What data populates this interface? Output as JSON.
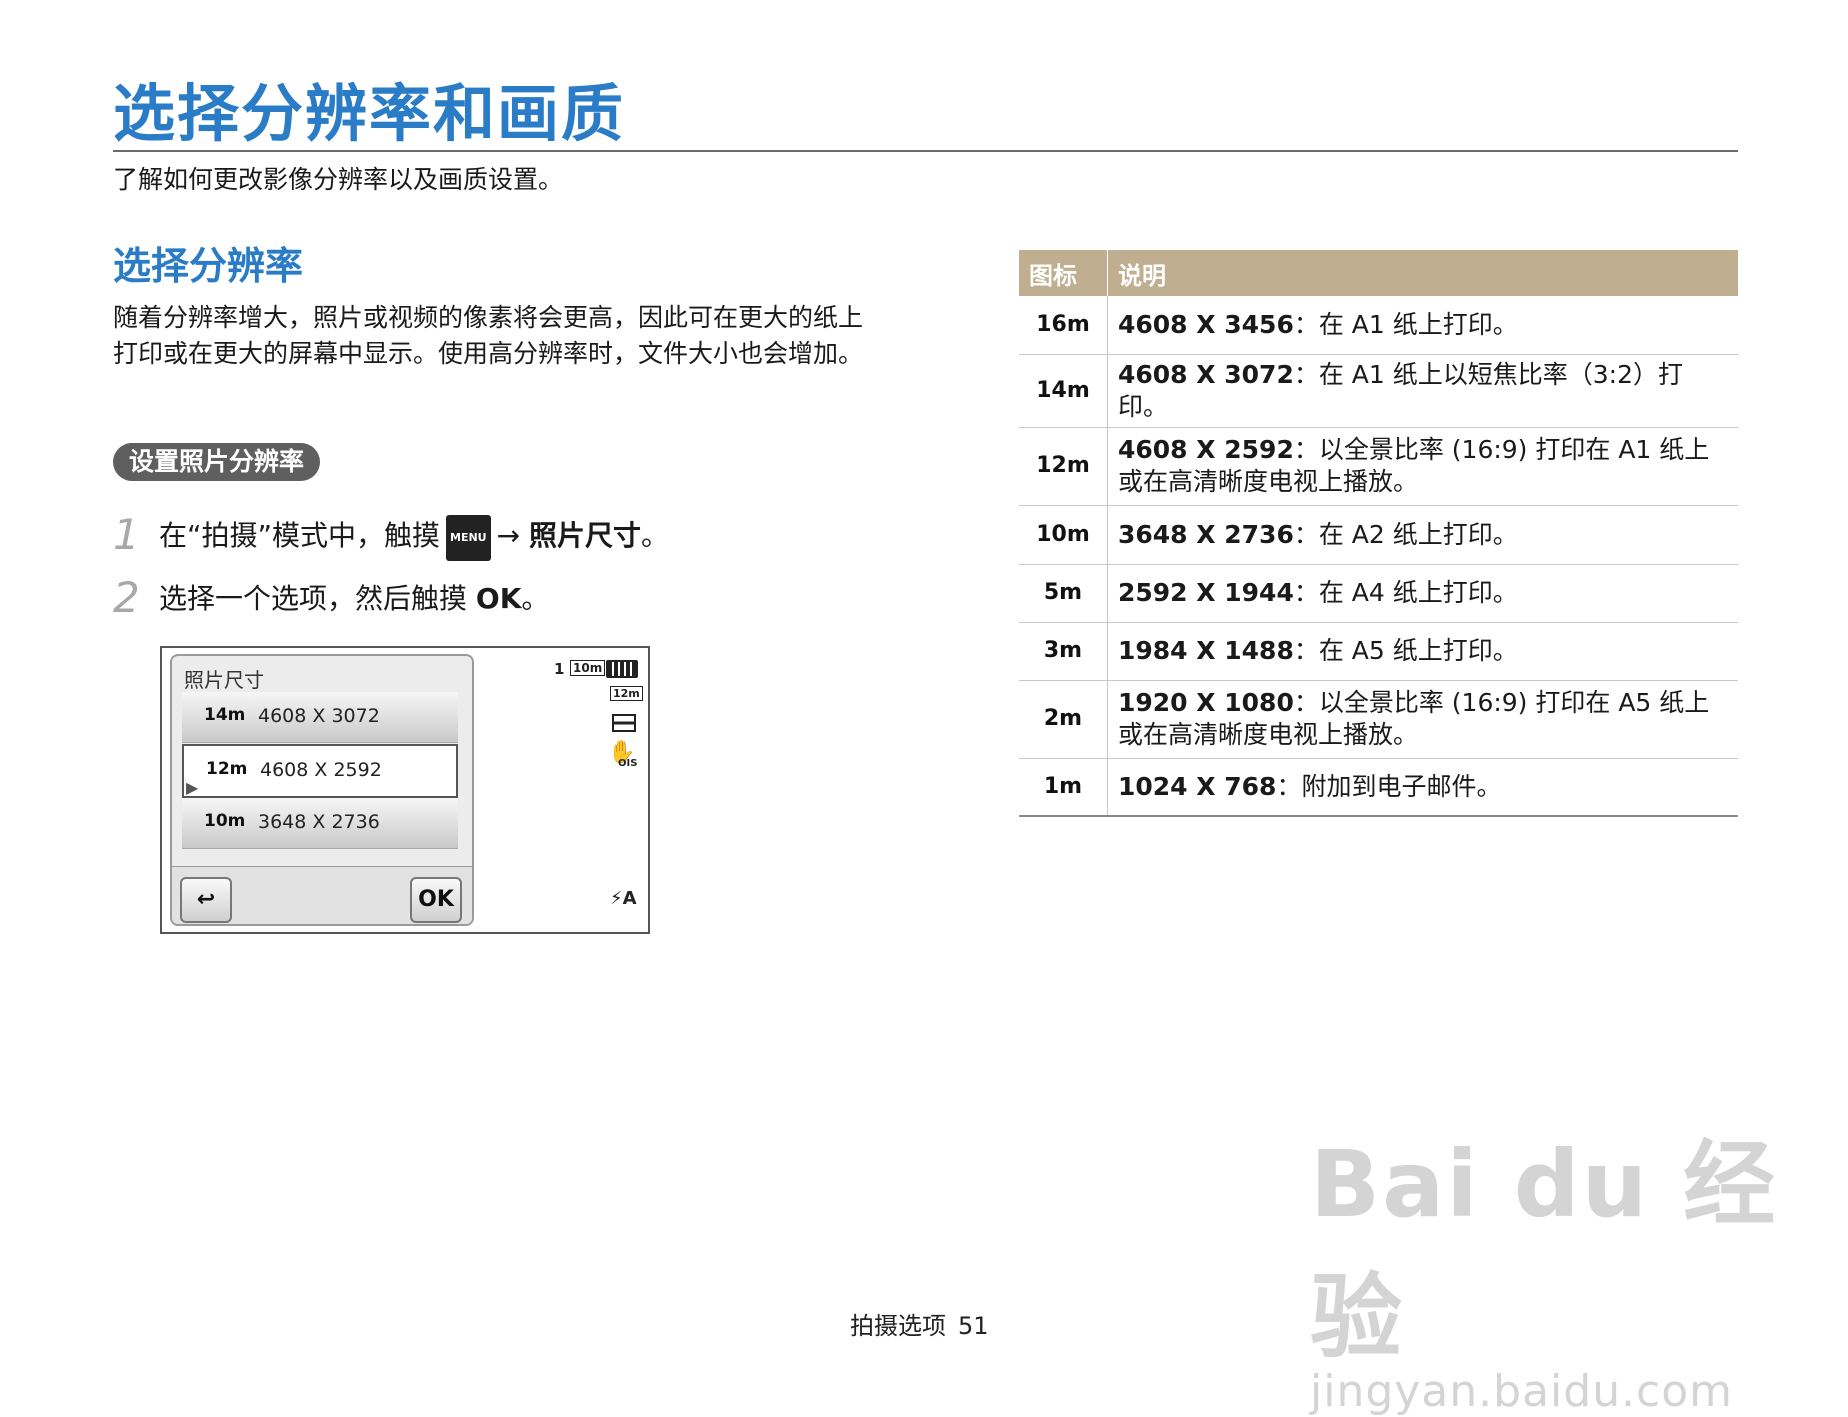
{
  "page": {
    "title": "选择分辨率和画质",
    "subtitle": "了解如何更改影像分辨率以及画质设置。"
  },
  "section": {
    "heading": "选择分辨率",
    "intro": "随着分辨率增大，照片或视频的像素将会更高，因此可在更大的纸上打印或在更大的屏幕中显示。使用高分辨率时，文件大小也会增加。",
    "pill": "设置照片分辨率"
  },
  "steps": [
    {
      "num": "1",
      "pre": "在“拍摄”模式中，触摸",
      "menu": "MENU",
      "arrow": "→",
      "bold": "照片尺寸",
      "post": "。"
    },
    {
      "num": "2",
      "pre": "选择一个选项，然后触摸",
      "bold": "OK",
      "post": "。"
    }
  ],
  "camera_screen": {
    "panel_title": "照片尺寸",
    "options": [
      {
        "icon": "14m",
        "label": "4608 X 3072"
      },
      {
        "icon": "12m",
        "label": "4608 X 2592",
        "selected": true
      },
      {
        "icon": "10m",
        "label": "3648 X 2736"
      }
    ],
    "back_icon": "↩",
    "ok_label": "OK",
    "status": {
      "count": "1",
      "res_icon": "10m",
      "battery_icon": "battery-icon",
      "wide_icon": "12m",
      "quality_icon": "quality-icon",
      "ois_icon": "OIS",
      "flash": "⚡A"
    }
  },
  "table": {
    "headers": {
      "icon": "图标",
      "desc": "说明"
    },
    "rows": [
      {
        "icon": "16m",
        "res": "4608 X 3456",
        "desc": "：在 A1 纸上打印。"
      },
      {
        "icon": "14m",
        "res": "4608 X 3072",
        "desc": "：在 A1 纸上以短焦比率（3:2）打印。"
      },
      {
        "icon": "12m",
        "res": "4608 X 2592",
        "desc": "：以全景比率 (16:9) 打印在 A1 纸上或在高清晰度电视上播放。"
      },
      {
        "icon": "10m",
        "res": "3648 X 2736",
        "desc": "：在 A2 纸上打印。"
      },
      {
        "icon": "5m",
        "res": "2592 X 1944",
        "desc": "：在 A4 纸上打印。"
      },
      {
        "icon": "3m",
        "res": "1984 X 1488",
        "desc": "：在 A5 纸上打印。"
      },
      {
        "icon": "2m",
        "res": "1920 X 1080",
        "desc": "：以全景比率 (16:9) 打印在 A5 纸上或在高清晰度电视上播放。"
      },
      {
        "icon": "1m",
        "res": "1024 X 768",
        "desc": "：附加到电子邮件。"
      }
    ]
  },
  "footer": {
    "label": "拍摄选项",
    "page": "51"
  },
  "watermark": {
    "main": "Bai du 经验",
    "sub": "jingyan.baidu.com"
  }
}
